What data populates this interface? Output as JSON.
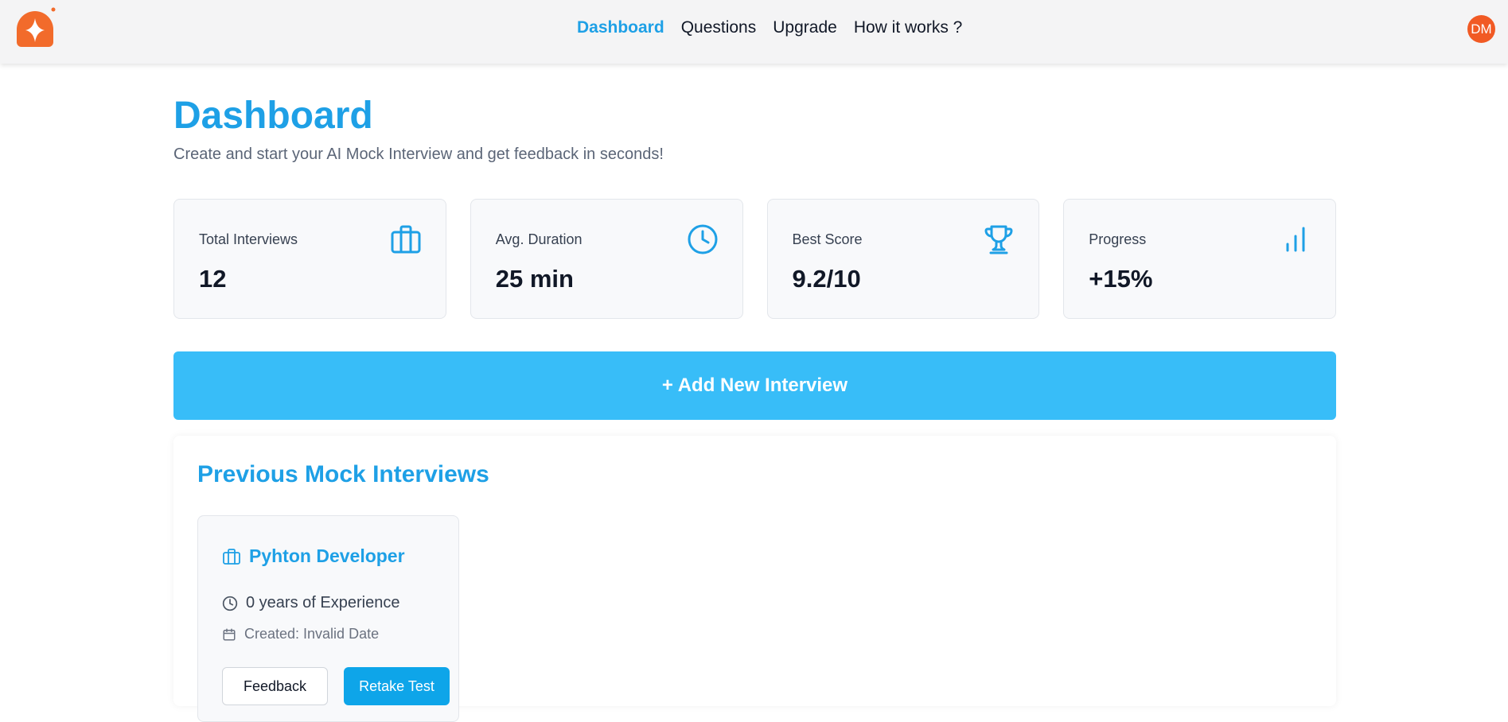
{
  "app": {
    "logo_icon": "sparkle-logo-icon",
    "brand_color": "#f26b2b",
    "accent_color": "#1ea0e6"
  },
  "nav": {
    "items": [
      {
        "label": "Dashboard",
        "active": true
      },
      {
        "label": "Questions",
        "active": false
      },
      {
        "label": "Upgrade",
        "active": false
      },
      {
        "label": "How it works ?",
        "active": false
      }
    ]
  },
  "user": {
    "initials": "DM",
    "avatar_color": "#f15a24"
  },
  "page": {
    "title": "Dashboard",
    "subtitle": "Create and start your AI Mock Interview and get feedback in seconds!"
  },
  "stats": [
    {
      "label": "Total Interviews",
      "value": "12",
      "icon": "briefcase-icon"
    },
    {
      "label": "Avg. Duration",
      "value": "25 min",
      "icon": "clock-icon"
    },
    {
      "label": "Best Score",
      "value": "9.2/10",
      "icon": "trophy-icon"
    },
    {
      "label": "Progress",
      "value": "+15%",
      "icon": "bar-chart-icon"
    }
  ],
  "add_button": {
    "label": "+ Add New Interview"
  },
  "previous": {
    "title": "Previous Mock Interviews",
    "interviews": [
      {
        "role": "Pyhton Developer",
        "experience": "0 years of Experience",
        "created": "Created: Invalid Date",
        "feedback_label": "Feedback",
        "retake_label": "Retake Test"
      }
    ]
  }
}
